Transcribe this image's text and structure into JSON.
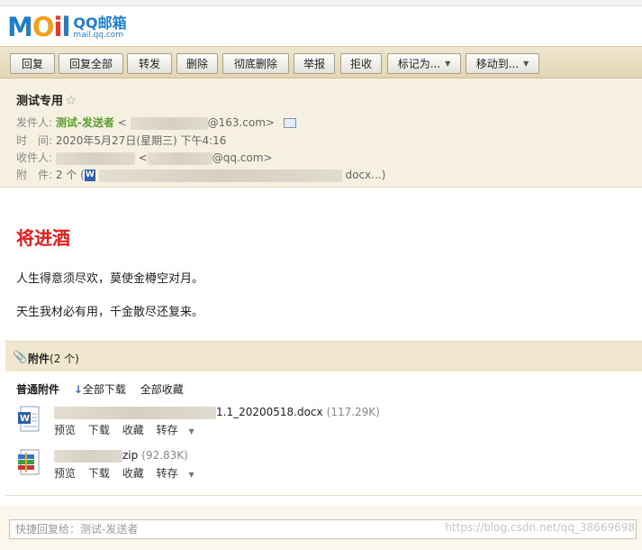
{
  "app": {
    "logo_letters": [
      "M",
      "O",
      "i",
      "l"
    ],
    "logo_cn": "QQ邮箱",
    "logo_url": "mail.qq.com"
  },
  "toolbar": {
    "reply": "回复",
    "reply_all": "回复全部",
    "forward": "转发",
    "delete": "删除",
    "delete_permanently": "彻底删除",
    "report": "举报",
    "reject": "拒收",
    "mark_as": "标记为...",
    "move_to": "移动到..."
  },
  "mail": {
    "subject": "测试专用",
    "star": "☆",
    "from_label": "发件人:",
    "from_name": "测试-发送者",
    "from_email_prefix": "<",
    "from_email_suffix": "@163.com>",
    "time_label": "时　间:",
    "time_value": "2020年5月27日(星期三) 下午4:16",
    "to_label": "收件人:",
    "to_email_prefix": "<",
    "to_email_suffix": "@qq.com>",
    "attach_label": "附　件:",
    "attach_count": "2 个 (",
    "attach_suffix": "docx...)"
  },
  "body": {
    "poem_title": "将进酒",
    "lines": [
      "人生得意须尽欢，莫使金樽空对月。",
      "天生我材必有用，千金散尽还复来。"
    ]
  },
  "attachments": {
    "header_bold": "附件",
    "header_count": "(2 个)",
    "normal_label": "普通附件",
    "download_all": "全部下载",
    "save_all": "全部收藏",
    "files": [
      {
        "name_tail": "1.1_20200518.docx",
        "size": "(117.29K)",
        "type": "word"
      },
      {
        "name_tail": "zip",
        "size": "(92.83K)",
        "type": "zip"
      }
    ],
    "actions": {
      "preview": "预览",
      "download": "下载",
      "save": "收藏",
      "transfer": "转存"
    }
  },
  "reply_box": {
    "placeholder": "快捷回复给：测试-发送者"
  },
  "watermark": "https://blog.csdn.net/qq_38669698",
  "colors": {
    "brand_blue": "#1d7fd0",
    "title_red": "#e21b1b",
    "sender_green": "#5a9e2f"
  }
}
